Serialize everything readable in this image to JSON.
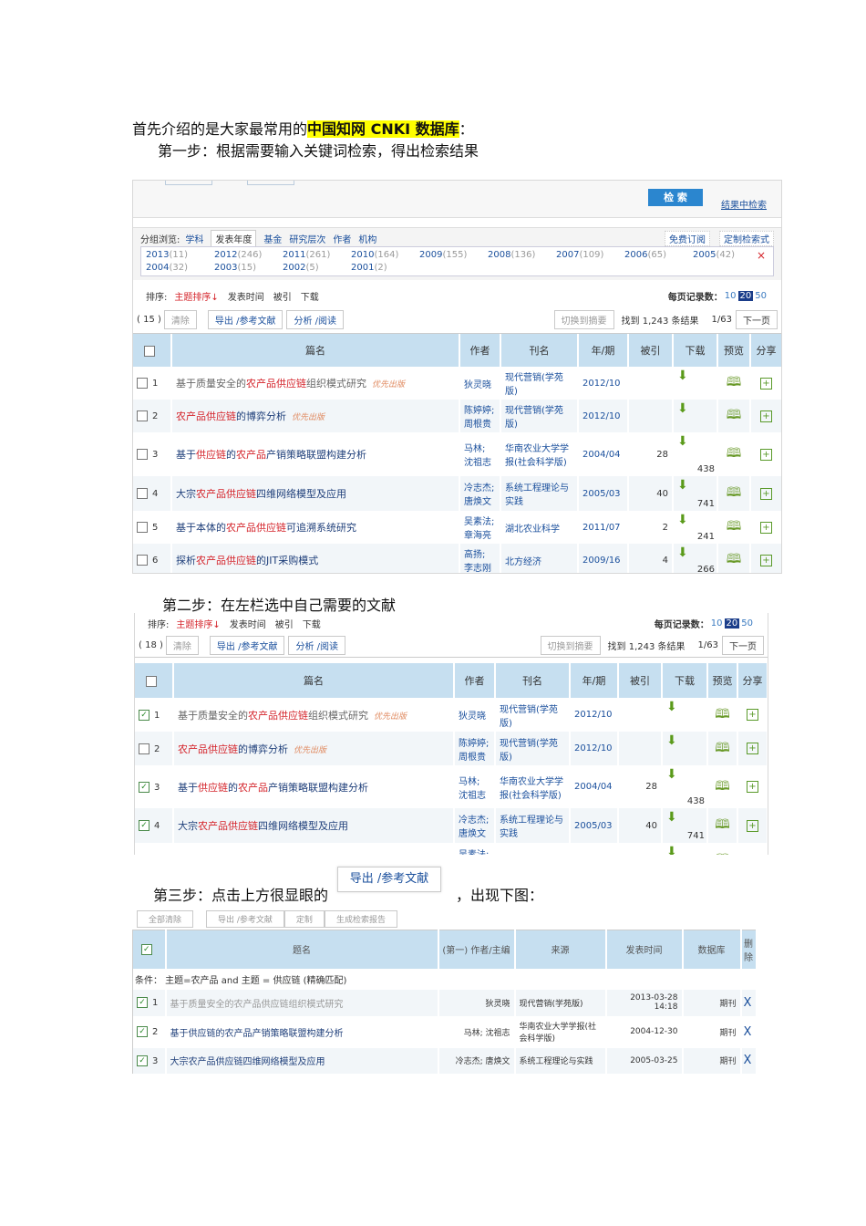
{
  "intro": {
    "before": "首先介绍的是大家最常用的",
    "highlight": "中国知网 CNKI 数据库",
    "after": "："
  },
  "step1": "第一步：根据需要输入关键词检索，得出检索结果",
  "step2": "第二步：在左栏选中自己需要的文献",
  "step3": {
    "before": "第三步：点击上方很显眼的",
    "button": "导出 /参考文献",
    "after": "，出现下图："
  },
  "search": {
    "search_btn": "检 索",
    "in_results": "结果中检索"
  },
  "group": {
    "label": "分组浏览:",
    "tabs": [
      "学科",
      "发表年度",
      "基金",
      "研究层次",
      "作者",
      "机构"
    ],
    "subscribe": "免费订阅",
    "custom": "定制检索式",
    "years": [
      [
        "2013",
        "(11)"
      ],
      [
        "2012",
        "(246)"
      ],
      [
        "2011",
        "(261)"
      ],
      [
        "2010",
        "(164)"
      ],
      [
        "2009",
        "(155)"
      ],
      [
        "2008",
        "(136)"
      ],
      [
        "2007",
        "(109)"
      ],
      [
        "2006",
        "(65)"
      ],
      [
        "2005",
        "(42)"
      ],
      [
        "2004",
        "(32)"
      ],
      [
        "2003",
        "(15)"
      ],
      [
        "2002",
        "(5)"
      ],
      [
        "2001",
        "(2)"
      ]
    ],
    "close": "×"
  },
  "sort": {
    "label": "排序:",
    "items": [
      "主题排序↓",
      "发表时间",
      "被引",
      "下载"
    ],
    "per_page_label": "每页记录数：",
    "per_page": [
      "10",
      "20",
      "50"
    ]
  },
  "toolbar1": {
    "count": "( 15 )",
    "clear": "清除",
    "export": "导出 /参考文献",
    "analyze": "分析 /阅读",
    "switch": "切换到摘要",
    "found": "找到 1,243 条结果",
    "page": "1/63",
    "next": "下一页"
  },
  "toolbar2": {
    "count": "( 18 )",
    "clear": "清除",
    "export": "导出 /参考文献",
    "analyze": "分析 /阅读",
    "switch": "切换到摘要",
    "found": "找到 1,243 条结果",
    "page": "1/63",
    "next": "下一页"
  },
  "headers": [
    "篇名",
    "作者",
    "刊名",
    "年/期",
    "被引",
    "下载",
    "预览",
    "分享"
  ],
  "priority": "优先出版",
  "results": [
    {
      "n": "1",
      "title": [
        [
          "基于质量安全的",
          0
        ],
        [
          "农产品供应链",
          1
        ],
        [
          "组织模式研究",
          0
        ]
      ],
      "plain": true,
      "pri": true,
      "author": "狄灵晓",
      "journal": "现代营销(学苑版)",
      "year": "2012/10",
      "cited": "",
      "downloads": ""
    },
    {
      "n": "2",
      "title": [
        [
          "农产品供应链",
          1
        ],
        [
          "的博弈分析",
          0
        ]
      ],
      "pri": true,
      "author": "陈婷婷; 周根贵",
      "journal": "现代营销(学苑版)",
      "year": "2012/10",
      "cited": "",
      "downloads": ""
    },
    {
      "n": "3",
      "title": [
        [
          "基于",
          0
        ],
        [
          "供应链",
          1
        ],
        [
          "的",
          0
        ],
        [
          "农产品",
          1
        ],
        [
          "产销策略联盟构建分析",
          0
        ]
      ],
      "author": "马林; 沈祖志",
      "journal": "华南农业大学学报(社会科学版)",
      "year": "2004/04",
      "cited": "28",
      "downloads": "438"
    },
    {
      "n": "4",
      "title": [
        [
          "大宗",
          0
        ],
        [
          "农产品供应链",
          1
        ],
        [
          "四维网络模型及应用",
          0
        ]
      ],
      "author": "冷志杰; 唐焕文",
      "journal": "系统工程理论与实践",
      "year": "2005/03",
      "cited": "40",
      "downloads": "741"
    },
    {
      "n": "5",
      "title": [
        [
          "基于本体的",
          0
        ],
        [
          "农产品供应链",
          1
        ],
        [
          "可追溯系统研究",
          0
        ]
      ],
      "author": "吴素法; 章海亮",
      "journal": "湖北农业科学",
      "year": "2011/07",
      "cited": "2",
      "downloads": "241"
    },
    {
      "n": "6",
      "title": [
        [
          "探析",
          0
        ],
        [
          "农产品供应链",
          1
        ],
        [
          "的JIT采购模式",
          0
        ]
      ],
      "author": "高扬; 李志刚",
      "journal": "北方经济",
      "year": "2009/16",
      "cited": "4",
      "downloads": "266"
    }
  ],
  "checked2": [
    true,
    false,
    true,
    true
  ],
  "export": {
    "buttons": [
      "全部清除",
      "导出 /参考文献",
      "定制",
      "生成检索报告"
    ],
    "headers": [
      "题名",
      "(第一) 作者/主编",
      "来源",
      "发表时间",
      "数据库",
      "删除"
    ],
    "condition": "条件：  主题=农产品  and 主题 = 供应链 (精确匹配)",
    "rows": [
      {
        "n": "1",
        "title": "基于质量安全的农产品供应链组织模式研究",
        "author": "狄灵晓",
        "source": "现代营销(学苑版)",
        "date": "2013-03-28 14:18",
        "db": "期刊",
        "del": "X"
      },
      {
        "n": "2",
        "title": "基于供应链的农产品产销策略联盟构建分析",
        "author": "马林; 沈祖志",
        "source": "华南农业大学学报(社会科学版)",
        "date": "2004-12-30",
        "db": "期刊",
        "del": "X"
      },
      {
        "n": "3",
        "title": "大宗农产品供应链四维网络模型及应用",
        "author": "冷志杰; 唐焕文",
        "source": "系统工程理论与实践",
        "date": "2005-03-25",
        "db": "期刊",
        "del": "X"
      }
    ]
  }
}
